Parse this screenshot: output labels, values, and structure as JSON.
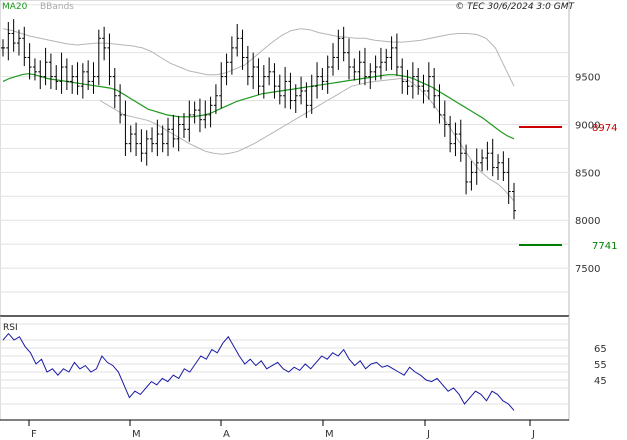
{
  "chart_data": [
    {
      "type": "ohlc",
      "legend": [
        {
          "name": "MA20",
          "color": "#1e9a1e"
        },
        {
          "name": "BBands",
          "color": "#aaaaaa"
        }
      ],
      "source_note": "© TEC 30/6/2024 3:0 GMT",
      "x_months": [
        "F",
        "M",
        "A",
        "M",
        "J",
        "J"
      ],
      "ylim": [
        7000,
        10300
      ],
      "yticks": [
        {
          "value": 9500,
          "label": "9500"
        },
        {
          "value": 9000,
          "label": "9000"
        },
        {
          "value": 8500,
          "label": "8500"
        },
        {
          "value": 8000,
          "label": "8000"
        },
        {
          "value": 7500,
          "label": "7500"
        }
      ],
      "grid": true,
      "levels": [
        {
          "value": 8974,
          "label": "8974",
          "color": "#cc0000"
        },
        {
          "value": 7741,
          "label": "7741",
          "color": "#008000"
        }
      ],
      "closes": [
        9800,
        9950,
        9850,
        9900,
        9700,
        9600,
        9550,
        9500,
        9650,
        9500,
        9450,
        9600,
        9450,
        9500,
        9400,
        9550,
        9450,
        9500,
        9900,
        9800,
        9500,
        9300,
        9100,
        8800,
        8900,
        8800,
        8700,
        8850,
        8800,
        8900,
        8800,
        8950,
        8850,
        9000,
        8950,
        9100,
        9150,
        9050,
        9100,
        9200,
        9300,
        9500,
        9650,
        9800,
        9900,
        9700,
        9500,
        9600,
        9400,
        9500,
        9550,
        9400,
        9300,
        9450,
        9250,
        9300,
        9350,
        9200,
        9400,
        9500,
        9450,
        9600,
        9700,
        9900,
        9750,
        9600,
        9550,
        9650,
        9500,
        9550,
        9600,
        9650,
        9700,
        9800,
        9600,
        9450,
        9400,
        9500,
        9400,
        9350,
        9500,
        9300,
        9100,
        9000,
        8800,
        8900,
        8700,
        8400,
        8500,
        8600,
        8650,
        8700,
        8550,
        8600,
        8500,
        8300,
        8100
      ],
      "ma20": [
        9450,
        9480,
        9500,
        9520,
        9530,
        9520,
        9500,
        9480,
        9470,
        9460,
        9450,
        9440,
        9430,
        9420,
        9410,
        9400,
        9390,
        9380,
        9360,
        9320,
        9280,
        9240,
        9200,
        9160,
        9140,
        9120,
        9100,
        9090,
        9080,
        9080,
        9080,
        9090,
        9100,
        9120,
        9150,
        9180,
        9210,
        9240,
        9260,
        9280,
        9300,
        9320,
        9330,
        9340,
        9350,
        9360,
        9370,
        9380,
        9390,
        9400,
        9410,
        9420,
        9430,
        9440,
        9450,
        9460,
        9470,
        9480,
        9490,
        9500,
        9510,
        9520,
        9520,
        9510,
        9500,
        9480,
        9450,
        9420,
        9390,
        9350,
        9310,
        9270,
        9230,
        9190,
        9150,
        9110,
        9070,
        9020,
        8970,
        8920,
        8880,
        8850
      ],
      "bb_upper": [
        10000,
        9980,
        9950,
        9920,
        9900,
        9880,
        9860,
        9840,
        9830,
        9840,
        9850,
        9850,
        9840,
        9830,
        9820,
        9800,
        9760,
        9700,
        9640,
        9600,
        9560,
        9540,
        9520,
        9520,
        9540,
        9580,
        9620,
        9700,
        9780,
        9860,
        9930,
        9980,
        10000,
        9990,
        9960,
        9940,
        9920,
        9910,
        9900,
        9900,
        9880,
        9870,
        9860,
        9860,
        9870,
        9880,
        9900,
        9920,
        9940,
        9950,
        9950,
        9940,
        9900,
        9800,
        9600,
        9400
      ],
      "bb_lower": [
        9250,
        9200,
        9150,
        9100,
        9080,
        9060,
        9040,
        9000,
        8950,
        8900,
        8850,
        8800,
        8760,
        8720,
        8700,
        8690,
        8700,
        8720,
        8760,
        8800,
        8850,
        8900,
        8950,
        9000,
        9050,
        9100,
        9150,
        9200,
        9250,
        9300,
        9350,
        9400,
        9420,
        9440,
        9450,
        9460,
        9470,
        9480,
        9460,
        9400,
        9320,
        9220,
        9100,
        8980,
        8850,
        8720,
        8600,
        8500,
        8430,
        8380,
        8300,
        8200
      ],
      "rsi": {
        "label": "RSI",
        "ylim": [
          20,
          85
        ],
        "yticks": [
          {
            "value": 65,
            "label": "65"
          },
          {
            "value": 55,
            "label": "55"
          },
          {
            "value": 45,
            "label": "45"
          }
        ],
        "values": [
          70,
          74,
          70,
          72,
          66,
          62,
          55,
          58,
          50,
          52,
          48,
          52,
          50,
          56,
          52,
          54,
          50,
          52,
          60,
          56,
          54,
          50,
          42,
          34,
          38,
          36,
          40,
          44,
          42,
          46,
          44,
          48,
          46,
          52,
          50,
          55,
          60,
          58,
          64,
          62,
          68,
          72,
          66,
          60,
          55,
          58,
          54,
          57,
          52,
          54,
          56,
          52,
          50,
          53,
          51,
          55,
          52,
          56,
          60,
          58,
          62,
          60,
          64,
          58,
          54,
          57,
          52,
          55,
          56,
          53,
          54,
          52,
          50,
          48,
          53,
          50,
          48,
          45,
          44,
          46,
          42,
          38,
          40,
          36,
          30,
          34,
          38,
          36,
          32,
          38,
          36,
          32,
          30,
          26
        ],
        "color": "#1a1aa6"
      }
    }
  ]
}
